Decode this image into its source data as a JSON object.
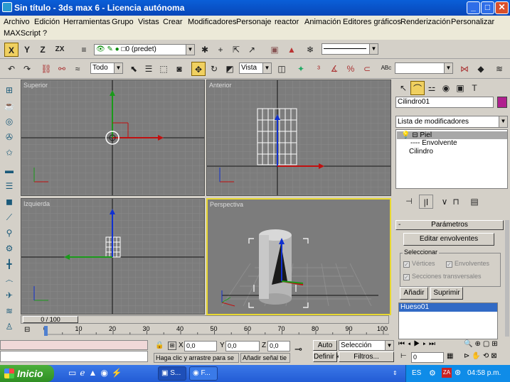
{
  "window": {
    "title": "Sin título - 3ds max 6 - Licencia autónoma",
    "min": "_",
    "max": "□",
    "close": "✕"
  },
  "menu": {
    "items": [
      "Archivo",
      "Edición",
      "Herramientas",
      "Grupo",
      "Vistas",
      "Crear",
      "Modificadores",
      "Personaje",
      "reactor",
      "Animación",
      "Editores gráficos",
      "Renderización",
      "Personalizar"
    ],
    "items2": [
      "MAXScript",
      "?"
    ]
  },
  "toolbar1": {
    "axis_x": "X",
    "axis_y": "Y",
    "axis_z": "Z",
    "axis_zx": "ZX",
    "layer_select": "0 (predet)"
  },
  "toolbar2": {
    "select_filter": "Todo",
    "coord_system": "Vista"
  },
  "viewports": {
    "top": "Superior",
    "front": "Anterior",
    "left": "Izquierda",
    "perspective": "Perspectiva"
  },
  "command_panel": {
    "object_name": "Cilindro01",
    "object_color": "#b0208f",
    "modifier_list": "Lista de modificadores",
    "stack": [
      "Piel",
      "Envolvente",
      "Cilindro"
    ],
    "rollout_title": "Parámetros",
    "edit_envelopes": "Editar envolventes",
    "select_group": "Seleccionar",
    "vertices": "Vértices",
    "envelopes": "Envolventes",
    "cross_sections": "Secciones transversales",
    "add": "Añadir",
    "remove": "Suprimir",
    "bones": [
      "Hueso01"
    ],
    "rollout_minus": "-"
  },
  "timeline": {
    "frame": "0 / 100",
    "ticks": [
      "0",
      "10",
      "20",
      "30",
      "40",
      "50",
      "60",
      "70",
      "80",
      "90",
      "100"
    ]
  },
  "status": {
    "x_label": "X",
    "x_val": "0,0",
    "y_label": "Y",
    "y_val": "0,0",
    "z_label": "Z",
    "z_val": "0,0",
    "prompt": "Haga clic y arrastre para se",
    "add_key": "Añadir señal tie",
    "auto": "Auto",
    "set_key": "Definir k",
    "key_filter": "Selección",
    "filters": "Filtros...",
    "frame_field": "0"
  },
  "taskbar": {
    "start": "Inicio",
    "task1": "S...",
    "task2": "F...",
    "lang": "ES",
    "time": "04:58 p.m."
  }
}
